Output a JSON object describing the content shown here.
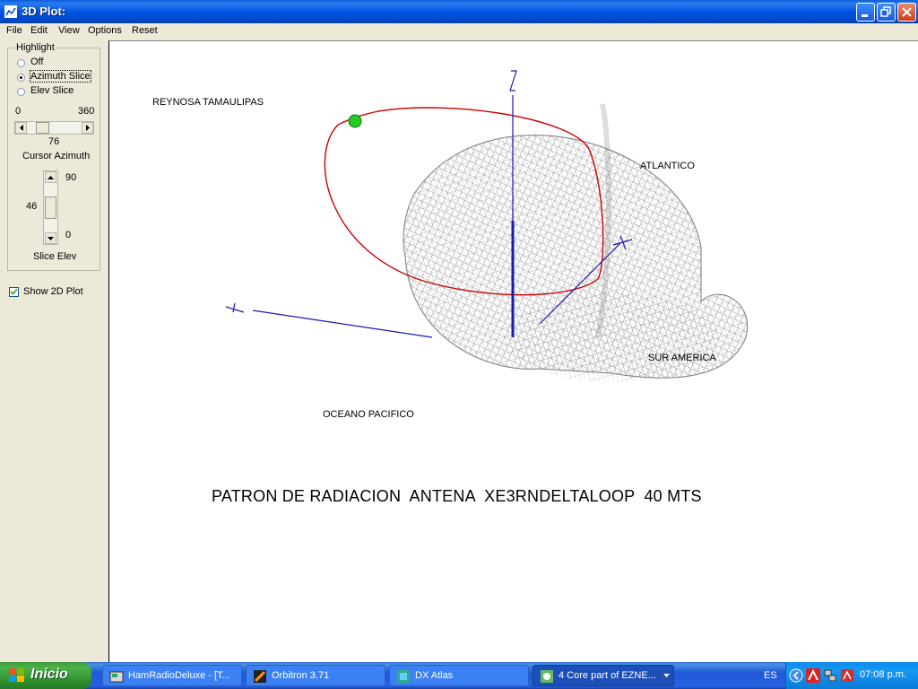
{
  "window": {
    "title": "3D Plot:",
    "icons": {
      "app": "plot-app-icon",
      "minimize": "minimize-icon",
      "restore": "restore-icon",
      "close": "close-icon"
    }
  },
  "menu": [
    "File",
    "Edit",
    "View",
    "Options",
    "Reset"
  ],
  "highlight": {
    "legend": "Highlight",
    "options": [
      "Off",
      "Azimuth Slice",
      "Elev Slice"
    ],
    "selected": "Azimuth Slice"
  },
  "azimuth_slider": {
    "min_label": "0",
    "max_label": "360",
    "value_label": "76",
    "value": 76,
    "caption": "Cursor Azimuth"
  },
  "elev_slider": {
    "max_label": "90",
    "min_label": "0",
    "value_label": "46",
    "value": 46,
    "caption": "Slice Elev"
  },
  "show_2d": {
    "label": "Show 2D Plot",
    "checked": true
  },
  "plot": {
    "labels": {
      "reynosa": "REYNOSA TAMAULIPAS",
      "atlantico": "ATLANTICO",
      "sur_america": "SUR AMERICA",
      "oceano": "OCEANO PACIFICO"
    },
    "title": "PATRON DE RADIACION  ANTENA  XE3RNDELTALOOP  40 MTS",
    "axes": {
      "z": "Z",
      "x": "X",
      "y": "Y"
    },
    "colors": {
      "mesh": "#8A8A8A",
      "slice": "#CC0000",
      "axis": "#1A1AB0",
      "cursor": "#22CC22"
    }
  },
  "taskbar": {
    "start": "Inicio",
    "tasks": [
      {
        "label": "HamRadioDeluxe - [T...",
        "icon": "ham-radio-icon",
        "active": false
      },
      {
        "label": "Orbitron 3.71",
        "icon": "orbitron-icon",
        "active": false
      },
      {
        "label": "DX Atlas",
        "icon": "dx-atlas-icon",
        "active": false
      },
      {
        "label": "4 Core part of EZNE...",
        "icon": "eznec-icon",
        "active": true
      }
    ],
    "lang": "ES",
    "clock": "07:08 p.m."
  }
}
